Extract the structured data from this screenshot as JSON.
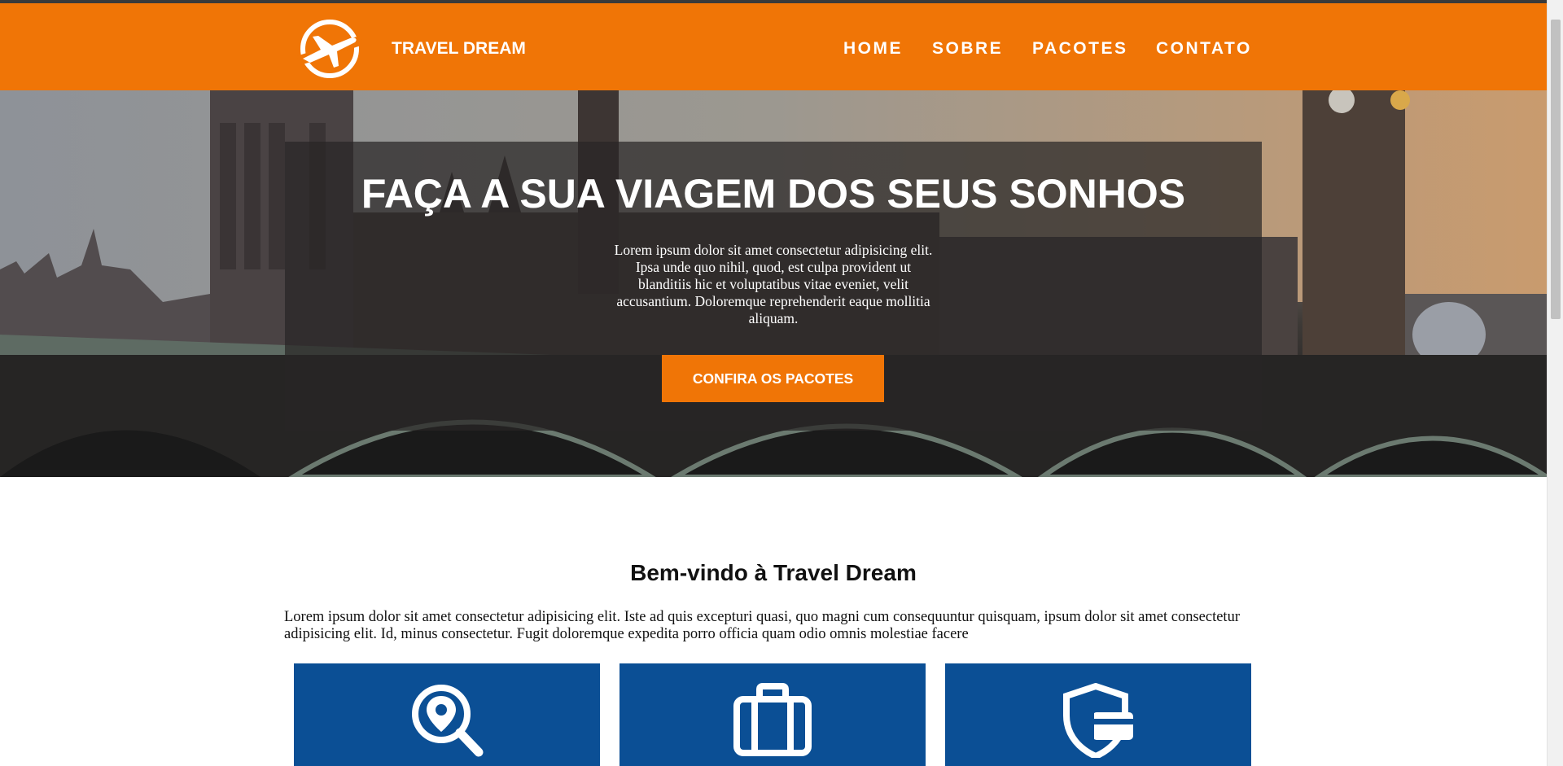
{
  "header": {
    "brand": "TRAVEL DREAM",
    "logo_icon": "airplane-circle-icon",
    "nav": [
      "HOME",
      "SOBRE",
      "PACOTES",
      "CONTATO"
    ]
  },
  "hero": {
    "title": "FAÇA A SUA VIAGEM DOS SEUS SONHOS",
    "text": "Lorem ipsum dolor sit amet consectetur adipisicing elit. Ipsa unde quo nihil, quod, est culpa provident ut blanditiis hic et voluptatibus vitae eveniet, velit accusantium. Doloremque reprehenderit eaque mollitia aliquam.",
    "cta_label": "CONFIRA OS PACOTES"
  },
  "welcome": {
    "title": "Bem-vindo à Travel Dream",
    "text": "Lorem ipsum dolor sit amet consectetur adipisicing elit. Iste ad quis excepturi quasi, quo magni cum consequuntur quisquam, ipsum dolor sit amet consectetur adipisicing elit. Id, minus consectetur. Fugit doloremque expedita porro officia quam odio omnis molestiae facere"
  },
  "cards": [
    {
      "icon": "location-search-icon"
    },
    {
      "icon": "briefcase-icon"
    },
    {
      "icon": "shield-card-icon"
    }
  ],
  "colors": {
    "accent": "#f07506",
    "card_blue": "#0b4f95"
  }
}
